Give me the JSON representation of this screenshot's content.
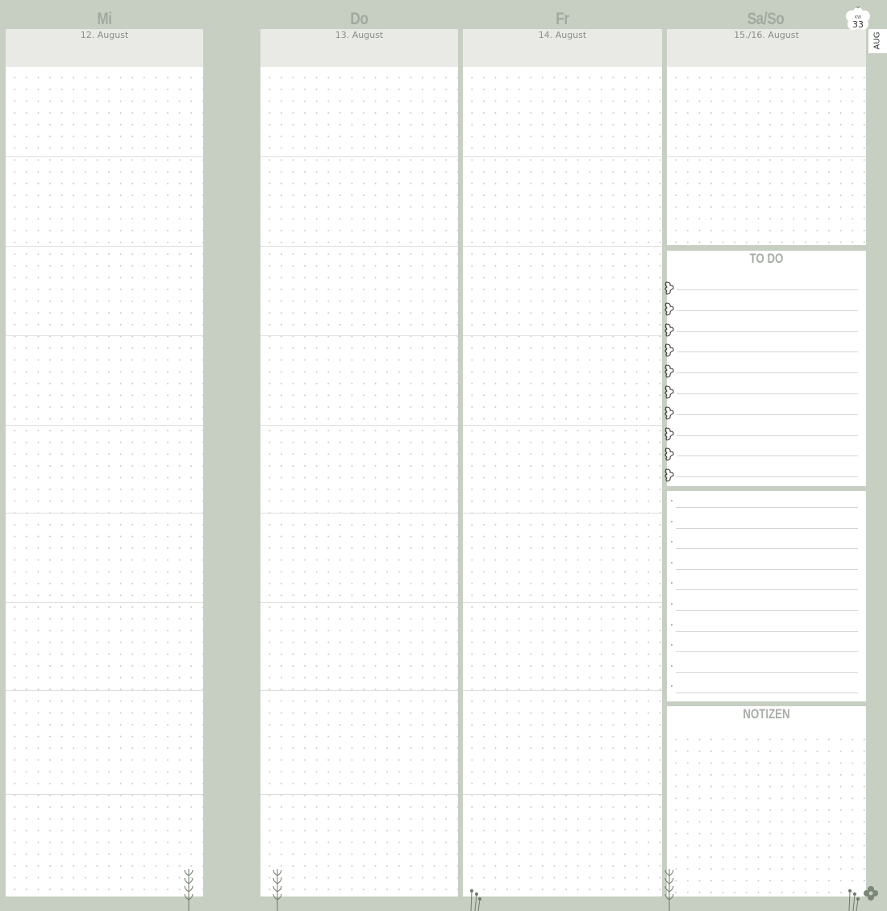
{
  "week": {
    "kw_label": "KW",
    "kw_number": "33",
    "month_tab": "AUG"
  },
  "days": [
    {
      "name": "Mi",
      "date": "12. August"
    },
    {
      "name": "Do",
      "date": "13. August"
    },
    {
      "name": "Fr",
      "date": "14. August"
    },
    {
      "name": "Sa/So",
      "date": "15./16. August"
    }
  ],
  "todo": {
    "title": "TO DO",
    "items": 10,
    "icon": "flower-checkbox-icon"
  },
  "notes_lines": 10,
  "notizen": {
    "title": "NOTIZEN"
  },
  "colors": {
    "background": "#c6cfc2",
    "date_band": "#e9eae6",
    "title": "#a2a9a0"
  },
  "icons": [
    "flower-kw-badge-icon",
    "sprig-decoration-icon",
    "flower-decoration-icon"
  ]
}
